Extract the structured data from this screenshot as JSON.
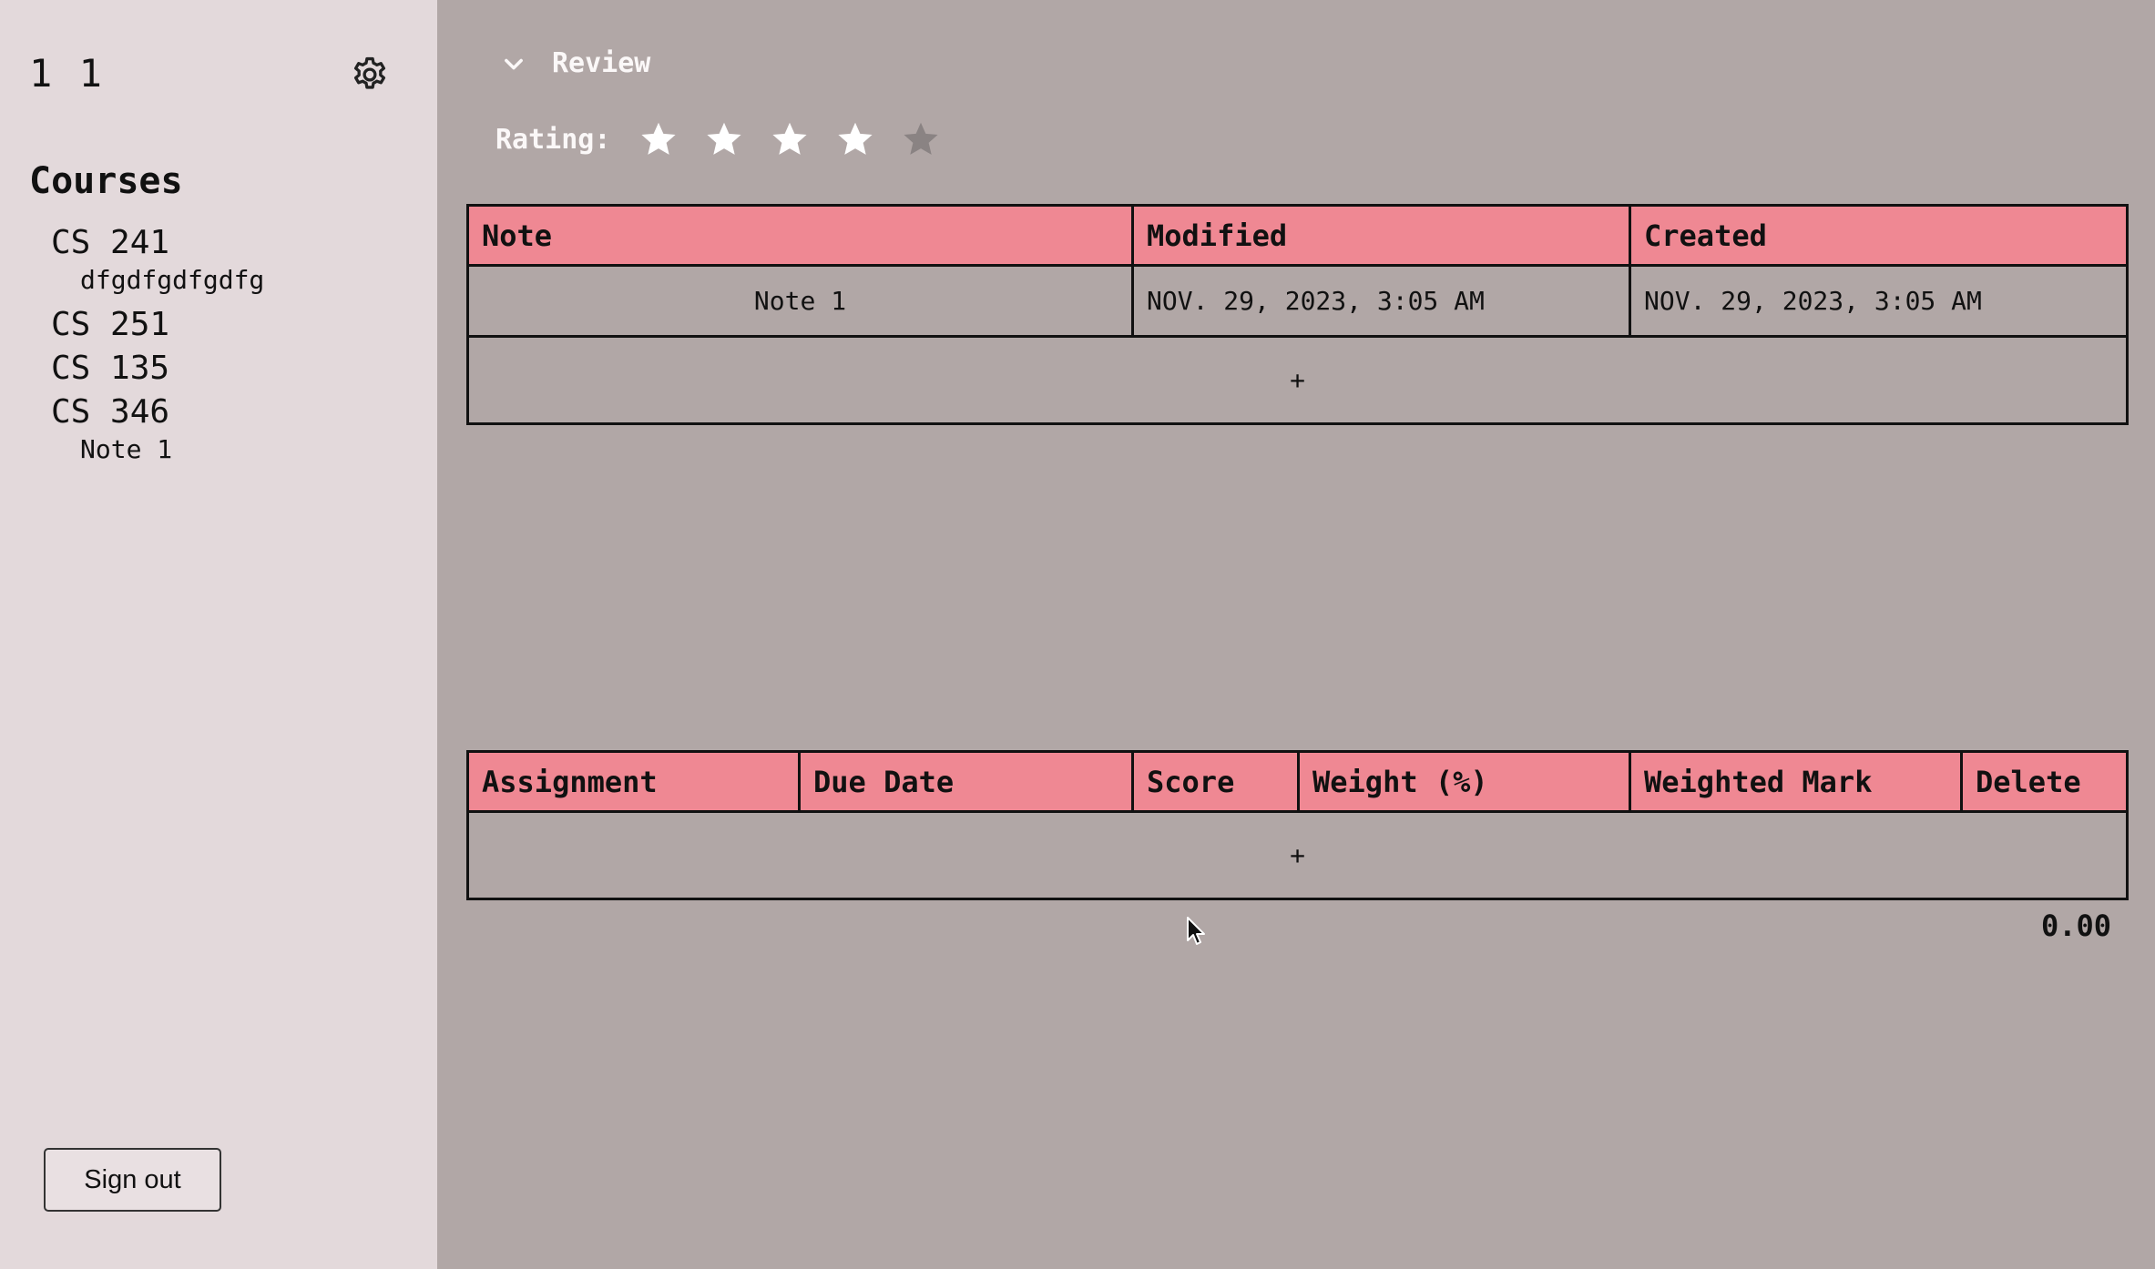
{
  "sidebar": {
    "user_name": "1 1",
    "settings_icon": "gear-icon",
    "courses_title": "Courses",
    "courses": [
      {
        "name": "CS 241",
        "notes": [
          "dfgdfgdfgdfg"
        ]
      },
      {
        "name": "CS 251",
        "notes": []
      },
      {
        "name": "CS 135",
        "notes": []
      },
      {
        "name": "CS 346",
        "notes": [
          "Note 1"
        ]
      }
    ],
    "sign_out_label": "Sign out"
  },
  "review": {
    "toggle_label": "Review",
    "toggle_icon": "chevron-down-icon",
    "rating_label": "Rating:",
    "rating": 4,
    "rating_max": 5
  },
  "notes_table": {
    "headers": [
      "Note",
      "Modified",
      "Created"
    ],
    "rows": [
      {
        "note": "Note 1",
        "modified": "NOV. 29, 2023, 3:05 AM",
        "created": "NOV. 29, 2023, 3:05 AM"
      }
    ],
    "add_label": "+"
  },
  "assignments_table": {
    "headers": [
      "Assignment",
      "Due Date",
      "Score",
      "Weight (%)",
      "Weighted Mark",
      "Delete"
    ],
    "rows": [],
    "add_label": "+"
  },
  "total": "0.00",
  "colors": {
    "sidebar_bg": "#e3d9db",
    "main_bg": "#b1a7a6",
    "header_bg": "#ef8893",
    "star_filled": "#ffffff",
    "star_empty": "#8a8383"
  }
}
